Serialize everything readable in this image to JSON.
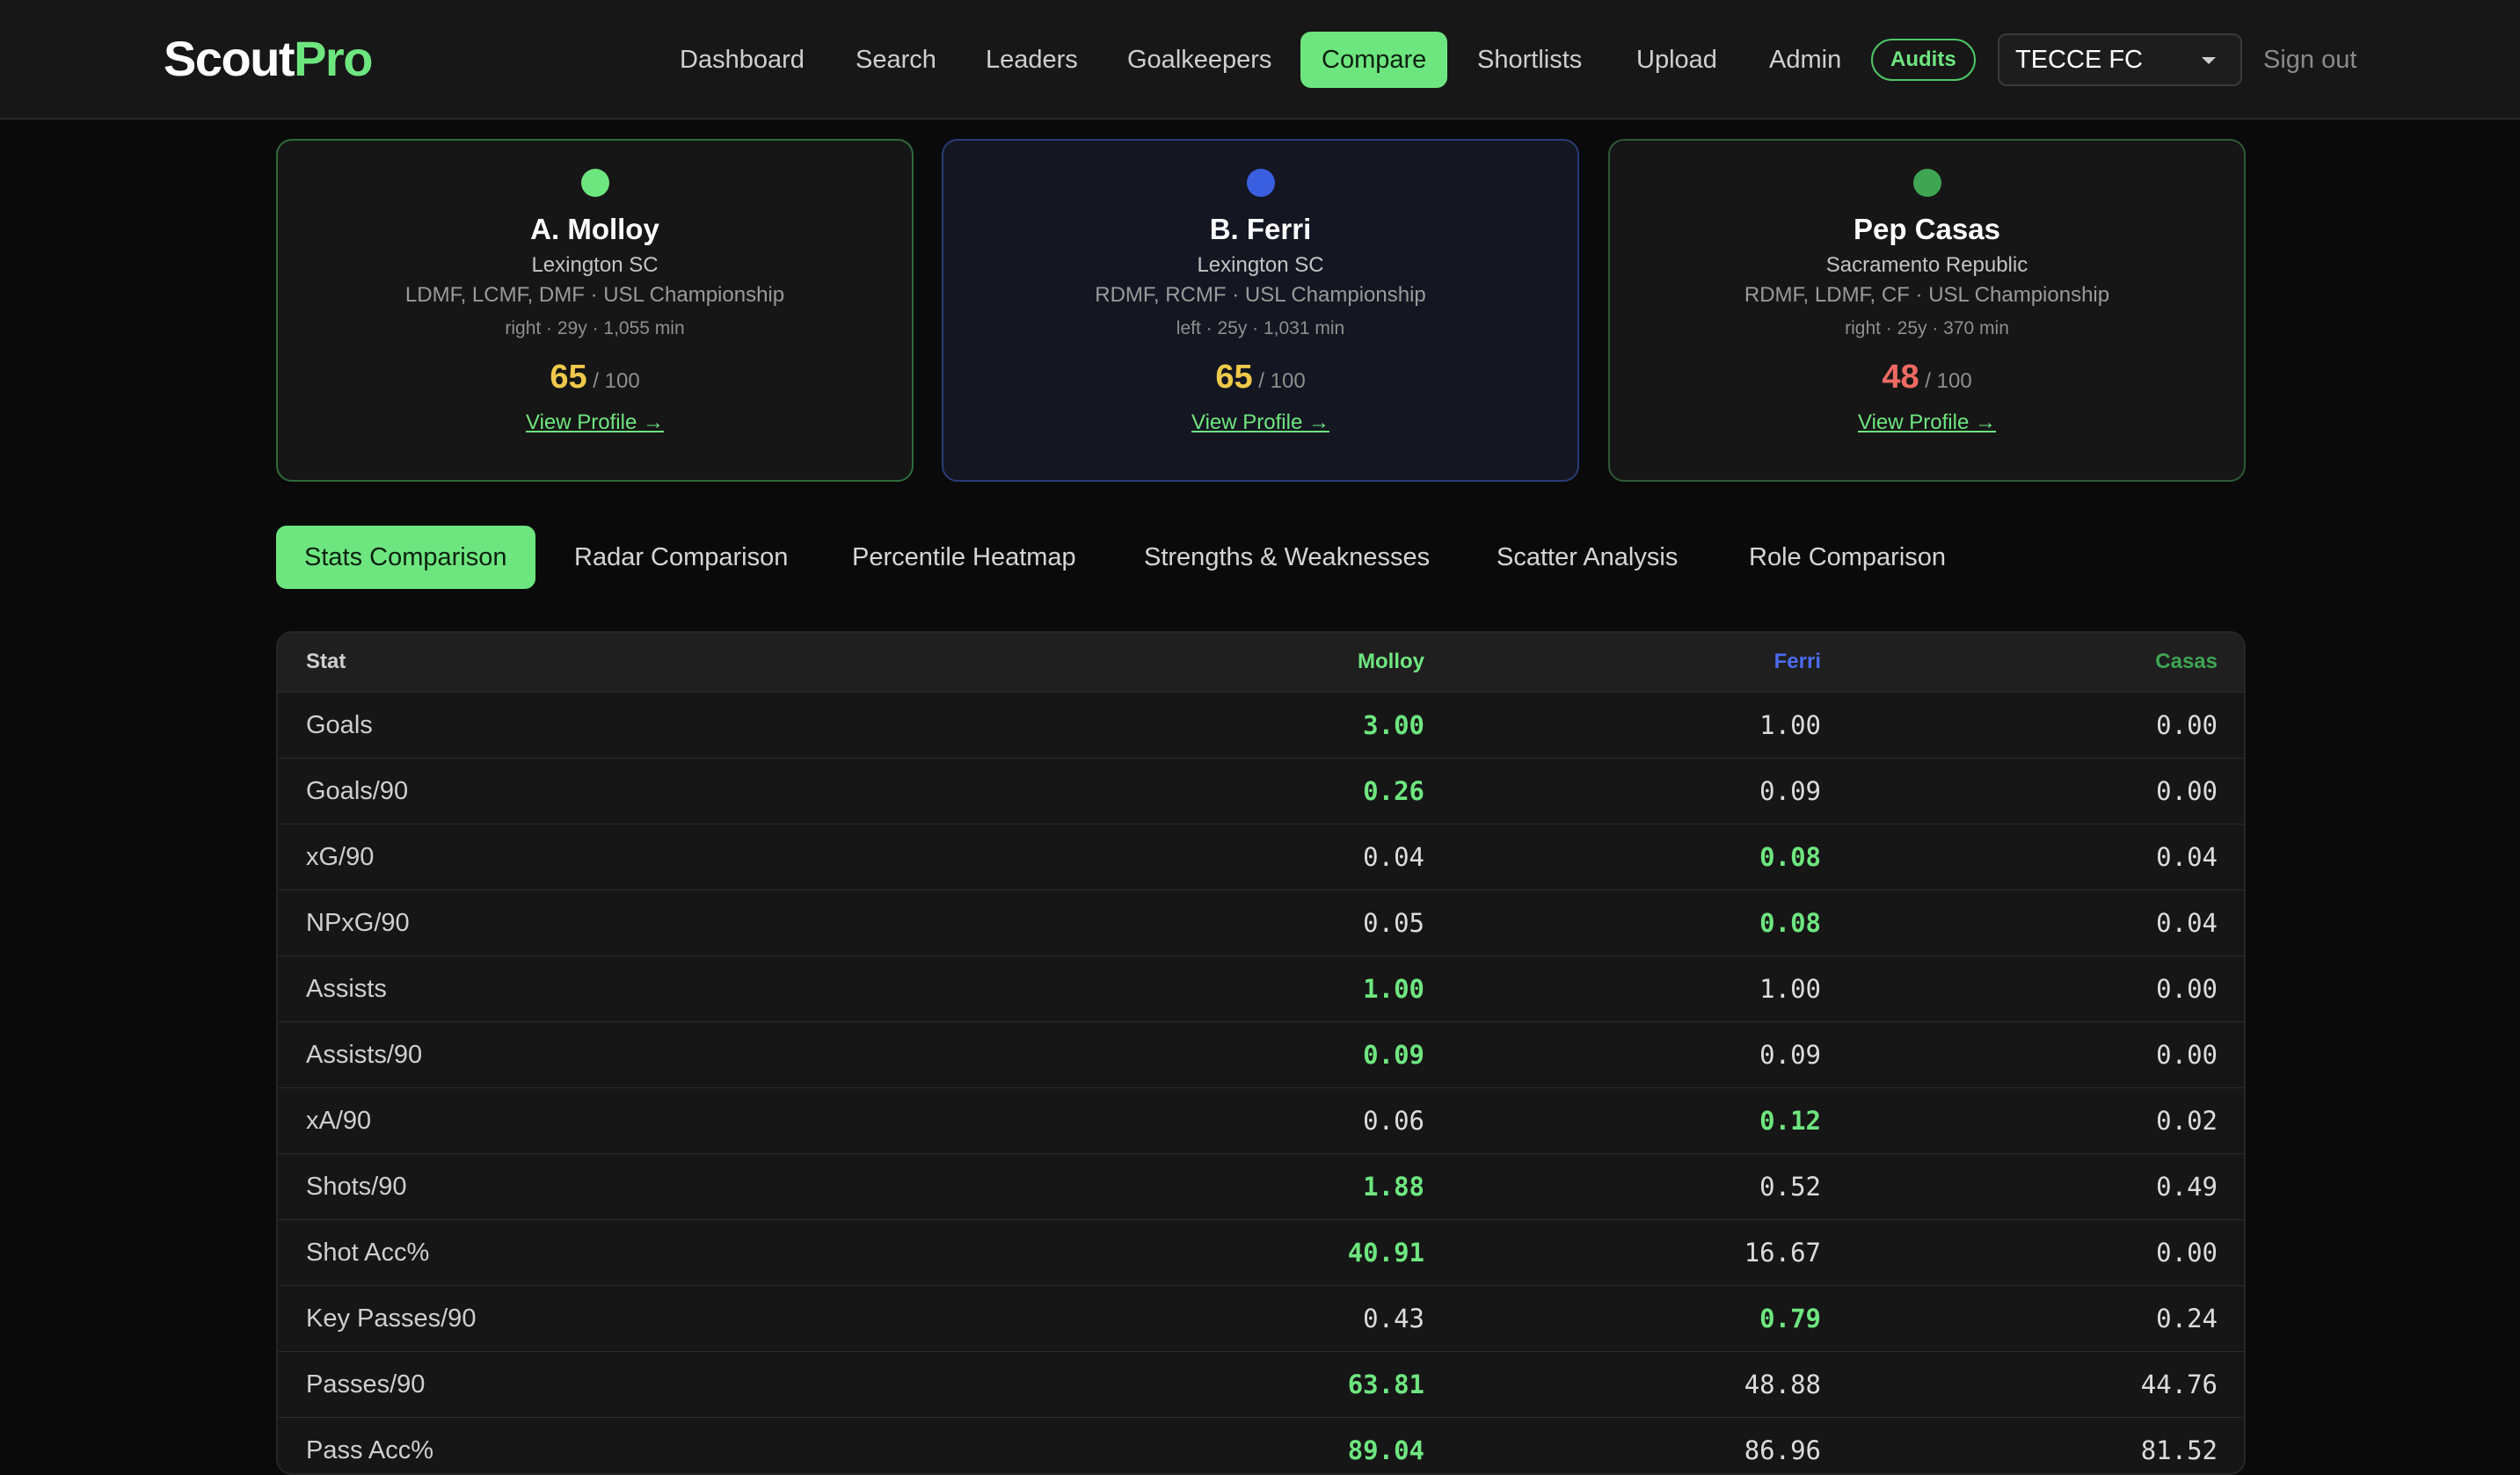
{
  "brand": {
    "part1": "Scout",
    "part2": "Pro"
  },
  "nav": {
    "links": [
      "Dashboard",
      "Search",
      "Leaders",
      "Goalkeepers",
      "Compare",
      "Shortlists",
      "Upload",
      "Admin"
    ],
    "active": "Compare",
    "audits_label": "Audits",
    "club_select_value": "TECCE FC",
    "signout_label": "Sign out"
  },
  "colors": {
    "accent": "#6ee67f",
    "player1": "#6ee67f",
    "player2": "#3a5ee0",
    "player3": "#3fa552",
    "score_mid": "#f0c94a",
    "score_low": "#ee6a62"
  },
  "players": [
    {
      "name": "A. Molloy",
      "club": "Lexington SC",
      "positions": "LDMF, LCMF, DMF · USL Championship",
      "meta": "right · 29y · 1,055 min",
      "score": "65",
      "score_max": "/ 100",
      "link": "View Profile →"
    },
    {
      "name": "B. Ferri",
      "club": "Lexington SC",
      "positions": "RDMF, RCMF · USL Championship",
      "meta": "left · 25y · 1,031 min",
      "score": "65",
      "score_max": "/ 100",
      "link": "View Profile →"
    },
    {
      "name": "Pep Casas",
      "club": "Sacramento Republic",
      "positions": "RDMF, LDMF, CF · USL Championship",
      "meta": "right · 25y · 370 min",
      "score": "48",
      "score_max": "/ 100",
      "link": "View Profile →"
    }
  ],
  "tabs": [
    "Stats Comparison",
    "Radar Comparison",
    "Percentile Heatmap",
    "Strengths & Weaknesses",
    "Scatter Analysis",
    "Role Comparison"
  ],
  "table": {
    "headers": [
      "Stat",
      "Molloy",
      "Ferri",
      "Casas"
    ],
    "rows": [
      {
        "stat": "Goals",
        "values": [
          "3.00",
          "1.00",
          "0.00"
        ],
        "best": 0
      },
      {
        "stat": "Goals/90",
        "values": [
          "0.26",
          "0.09",
          "0.00"
        ],
        "best": 0
      },
      {
        "stat": "xG/90",
        "values": [
          "0.04",
          "0.08",
          "0.04"
        ],
        "best": 1
      },
      {
        "stat": "NPxG/90",
        "values": [
          "0.05",
          "0.08",
          "0.04"
        ],
        "best": 1
      },
      {
        "stat": "Assists",
        "values": [
          "1.00",
          "1.00",
          "0.00"
        ],
        "best": 0
      },
      {
        "stat": "Assists/90",
        "values": [
          "0.09",
          "0.09",
          "0.00"
        ],
        "best": 0
      },
      {
        "stat": "xA/90",
        "values": [
          "0.06",
          "0.12",
          "0.02"
        ],
        "best": 1
      },
      {
        "stat": "Shots/90",
        "values": [
          "1.88",
          "0.52",
          "0.49"
        ],
        "best": 0
      },
      {
        "stat": "Shot Acc%",
        "values": [
          "40.91",
          "16.67",
          "0.00"
        ],
        "best": 0
      },
      {
        "stat": "Key Passes/90",
        "values": [
          "0.43",
          "0.79",
          "0.24"
        ],
        "best": 1
      },
      {
        "stat": "Passes/90",
        "values": [
          "63.81",
          "48.88",
          "44.76"
        ],
        "best": 0
      },
      {
        "stat": "Pass Acc%",
        "values": [
          "89.04",
          "86.96",
          "81.52"
        ],
        "best": 0
      }
    ]
  }
}
